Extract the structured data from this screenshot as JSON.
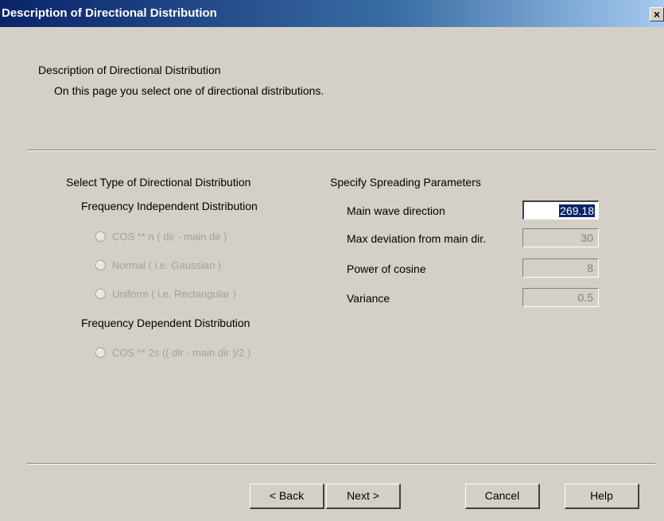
{
  "window": {
    "title": "Description of Directional Distribution",
    "close_glyph": "×"
  },
  "page": {
    "heading": "Description of Directional Distribution",
    "subheading": "On this page you select one of directional distributions."
  },
  "distribution": {
    "group_label": "Select Type of Directional Distribution",
    "independent_label": "Frequency Independent Distribution",
    "independent_options": [
      "COS ** n ( dir - main dir )",
      "Normal ( i.e. Gaussian )",
      "Uniform ( i.e. Rectangular )"
    ],
    "dependent_label": "Frequency Dependent Distribution",
    "dependent_options": [
      "COS ** 2s (( dir - main dir )/2 )"
    ]
  },
  "spreading": {
    "group_label": "Specify Spreading Parameters",
    "params": [
      {
        "label": "Main wave direction",
        "value": "269.18"
      },
      {
        "label": "Max deviation from main dir.",
        "value": "30"
      },
      {
        "label": "Power of cosine",
        "value": "8"
      },
      {
        "label": "Variance",
        "value": "0.5"
      }
    ]
  },
  "buttons": {
    "back": "< Back",
    "next": "Next >",
    "cancel": "Cancel",
    "help": "Help"
  }
}
